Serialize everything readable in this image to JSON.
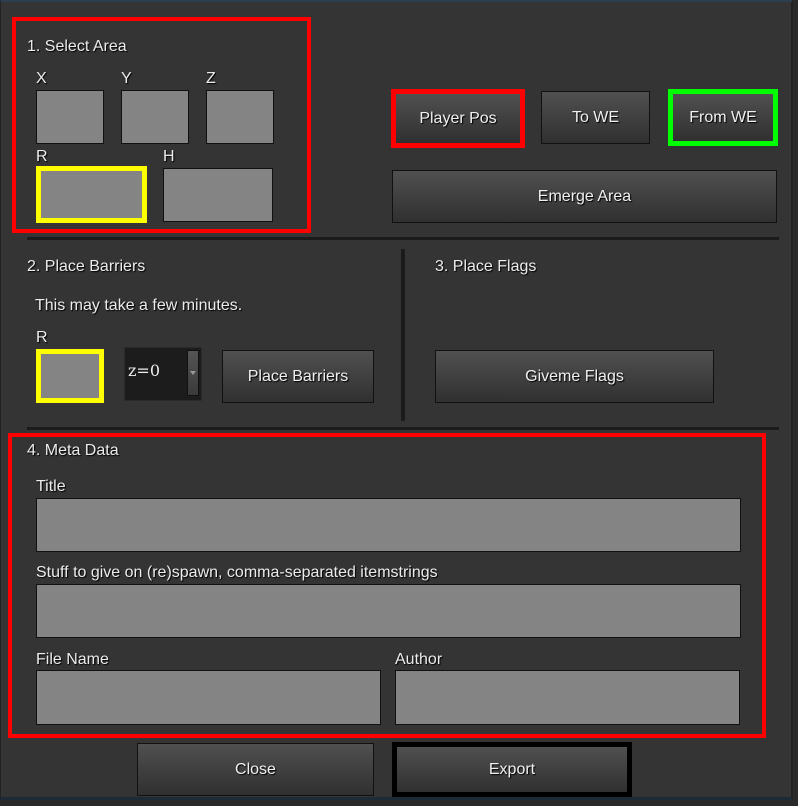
{
  "section1": {
    "title": "1. Select Area",
    "labels": {
      "x": "X",
      "y": "Y",
      "z": "Z",
      "r": "R",
      "h": "H"
    },
    "values": {
      "x": "",
      "y": "",
      "z": "",
      "r": "",
      "h": ""
    }
  },
  "buttons": {
    "player_pos": "Player Pos",
    "to_we": "To WE",
    "from_we": "From WE",
    "emerge_area": "Emerge Area",
    "place_barriers": "Place Barriers",
    "giveme_flags": "Giveme Flags",
    "close": "Close",
    "export": "Export"
  },
  "section2": {
    "title": "2. Place Barriers",
    "note": "This may take a few minutes.",
    "r_label": "R",
    "r_value": "",
    "dropdown_selected": "z=0"
  },
  "section3": {
    "title": "3. Place Flags"
  },
  "section4": {
    "title": "4. Meta Data",
    "title_label": "Title",
    "title_value": "",
    "items_label": "Stuff to give on (re)spawn, comma-separated itemstrings",
    "items_value": "",
    "filename_label": "File Name",
    "filename_value": "",
    "author_label": "Author",
    "author_value": ""
  },
  "highlight_colors": {
    "red": "#ff0000",
    "yellow": "#ffff00",
    "green": "#00ff00",
    "black": "#000000"
  }
}
